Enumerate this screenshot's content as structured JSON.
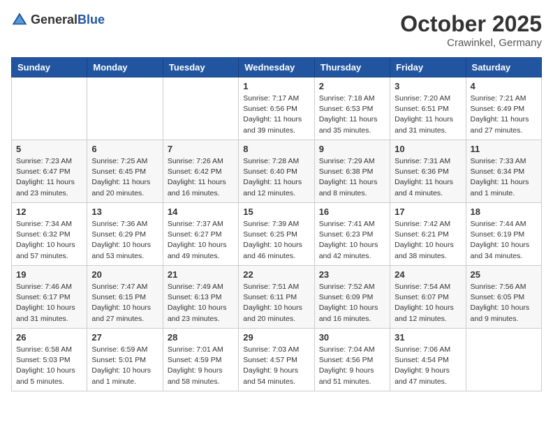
{
  "header": {
    "logo_general": "General",
    "logo_blue": "Blue",
    "month": "October 2025",
    "location": "Crawinkel, Germany"
  },
  "days_of_week": [
    "Sunday",
    "Monday",
    "Tuesday",
    "Wednesday",
    "Thursday",
    "Friday",
    "Saturday"
  ],
  "weeks": [
    [
      {
        "day": "",
        "info": ""
      },
      {
        "day": "",
        "info": ""
      },
      {
        "day": "",
        "info": ""
      },
      {
        "day": "1",
        "info": "Sunrise: 7:17 AM\nSunset: 6:56 PM\nDaylight: 11 hours\nand 39 minutes."
      },
      {
        "day": "2",
        "info": "Sunrise: 7:18 AM\nSunset: 6:53 PM\nDaylight: 11 hours\nand 35 minutes."
      },
      {
        "day": "3",
        "info": "Sunrise: 7:20 AM\nSunset: 6:51 PM\nDaylight: 11 hours\nand 31 minutes."
      },
      {
        "day": "4",
        "info": "Sunrise: 7:21 AM\nSunset: 6:49 PM\nDaylight: 11 hours\nand 27 minutes."
      }
    ],
    [
      {
        "day": "5",
        "info": "Sunrise: 7:23 AM\nSunset: 6:47 PM\nDaylight: 11 hours\nand 23 minutes."
      },
      {
        "day": "6",
        "info": "Sunrise: 7:25 AM\nSunset: 6:45 PM\nDaylight: 11 hours\nand 20 minutes."
      },
      {
        "day": "7",
        "info": "Sunrise: 7:26 AM\nSunset: 6:42 PM\nDaylight: 11 hours\nand 16 minutes."
      },
      {
        "day": "8",
        "info": "Sunrise: 7:28 AM\nSunset: 6:40 PM\nDaylight: 11 hours\nand 12 minutes."
      },
      {
        "day": "9",
        "info": "Sunrise: 7:29 AM\nSunset: 6:38 PM\nDaylight: 11 hours\nand 8 minutes."
      },
      {
        "day": "10",
        "info": "Sunrise: 7:31 AM\nSunset: 6:36 PM\nDaylight: 11 hours\nand 4 minutes."
      },
      {
        "day": "11",
        "info": "Sunrise: 7:33 AM\nSunset: 6:34 PM\nDaylight: 11 hours\nand 1 minute."
      }
    ],
    [
      {
        "day": "12",
        "info": "Sunrise: 7:34 AM\nSunset: 6:32 PM\nDaylight: 10 hours\nand 57 minutes."
      },
      {
        "day": "13",
        "info": "Sunrise: 7:36 AM\nSunset: 6:29 PM\nDaylight: 10 hours\nand 53 minutes."
      },
      {
        "day": "14",
        "info": "Sunrise: 7:37 AM\nSunset: 6:27 PM\nDaylight: 10 hours\nand 49 minutes."
      },
      {
        "day": "15",
        "info": "Sunrise: 7:39 AM\nSunset: 6:25 PM\nDaylight: 10 hours\nand 46 minutes."
      },
      {
        "day": "16",
        "info": "Sunrise: 7:41 AM\nSunset: 6:23 PM\nDaylight: 10 hours\nand 42 minutes."
      },
      {
        "day": "17",
        "info": "Sunrise: 7:42 AM\nSunset: 6:21 PM\nDaylight: 10 hours\nand 38 minutes."
      },
      {
        "day": "18",
        "info": "Sunrise: 7:44 AM\nSunset: 6:19 PM\nDaylight: 10 hours\nand 34 minutes."
      }
    ],
    [
      {
        "day": "19",
        "info": "Sunrise: 7:46 AM\nSunset: 6:17 PM\nDaylight: 10 hours\nand 31 minutes."
      },
      {
        "day": "20",
        "info": "Sunrise: 7:47 AM\nSunset: 6:15 PM\nDaylight: 10 hours\nand 27 minutes."
      },
      {
        "day": "21",
        "info": "Sunrise: 7:49 AM\nSunset: 6:13 PM\nDaylight: 10 hours\nand 23 minutes."
      },
      {
        "day": "22",
        "info": "Sunrise: 7:51 AM\nSunset: 6:11 PM\nDaylight: 10 hours\nand 20 minutes."
      },
      {
        "day": "23",
        "info": "Sunrise: 7:52 AM\nSunset: 6:09 PM\nDaylight: 10 hours\nand 16 minutes."
      },
      {
        "day": "24",
        "info": "Sunrise: 7:54 AM\nSunset: 6:07 PM\nDaylight: 10 hours\nand 12 minutes."
      },
      {
        "day": "25",
        "info": "Sunrise: 7:56 AM\nSunset: 6:05 PM\nDaylight: 10 hours\nand 9 minutes."
      }
    ],
    [
      {
        "day": "26",
        "info": "Sunrise: 6:58 AM\nSunset: 5:03 PM\nDaylight: 10 hours\nand 5 minutes."
      },
      {
        "day": "27",
        "info": "Sunrise: 6:59 AM\nSunset: 5:01 PM\nDaylight: 10 hours\nand 1 minute."
      },
      {
        "day": "28",
        "info": "Sunrise: 7:01 AM\nSunset: 4:59 PM\nDaylight: 9 hours\nand 58 minutes."
      },
      {
        "day": "29",
        "info": "Sunrise: 7:03 AM\nSunset: 4:57 PM\nDaylight: 9 hours\nand 54 minutes."
      },
      {
        "day": "30",
        "info": "Sunrise: 7:04 AM\nSunset: 4:56 PM\nDaylight: 9 hours\nand 51 minutes."
      },
      {
        "day": "31",
        "info": "Sunrise: 7:06 AM\nSunset: 4:54 PM\nDaylight: 9 hours\nand 47 minutes."
      },
      {
        "day": "",
        "info": ""
      }
    ]
  ]
}
